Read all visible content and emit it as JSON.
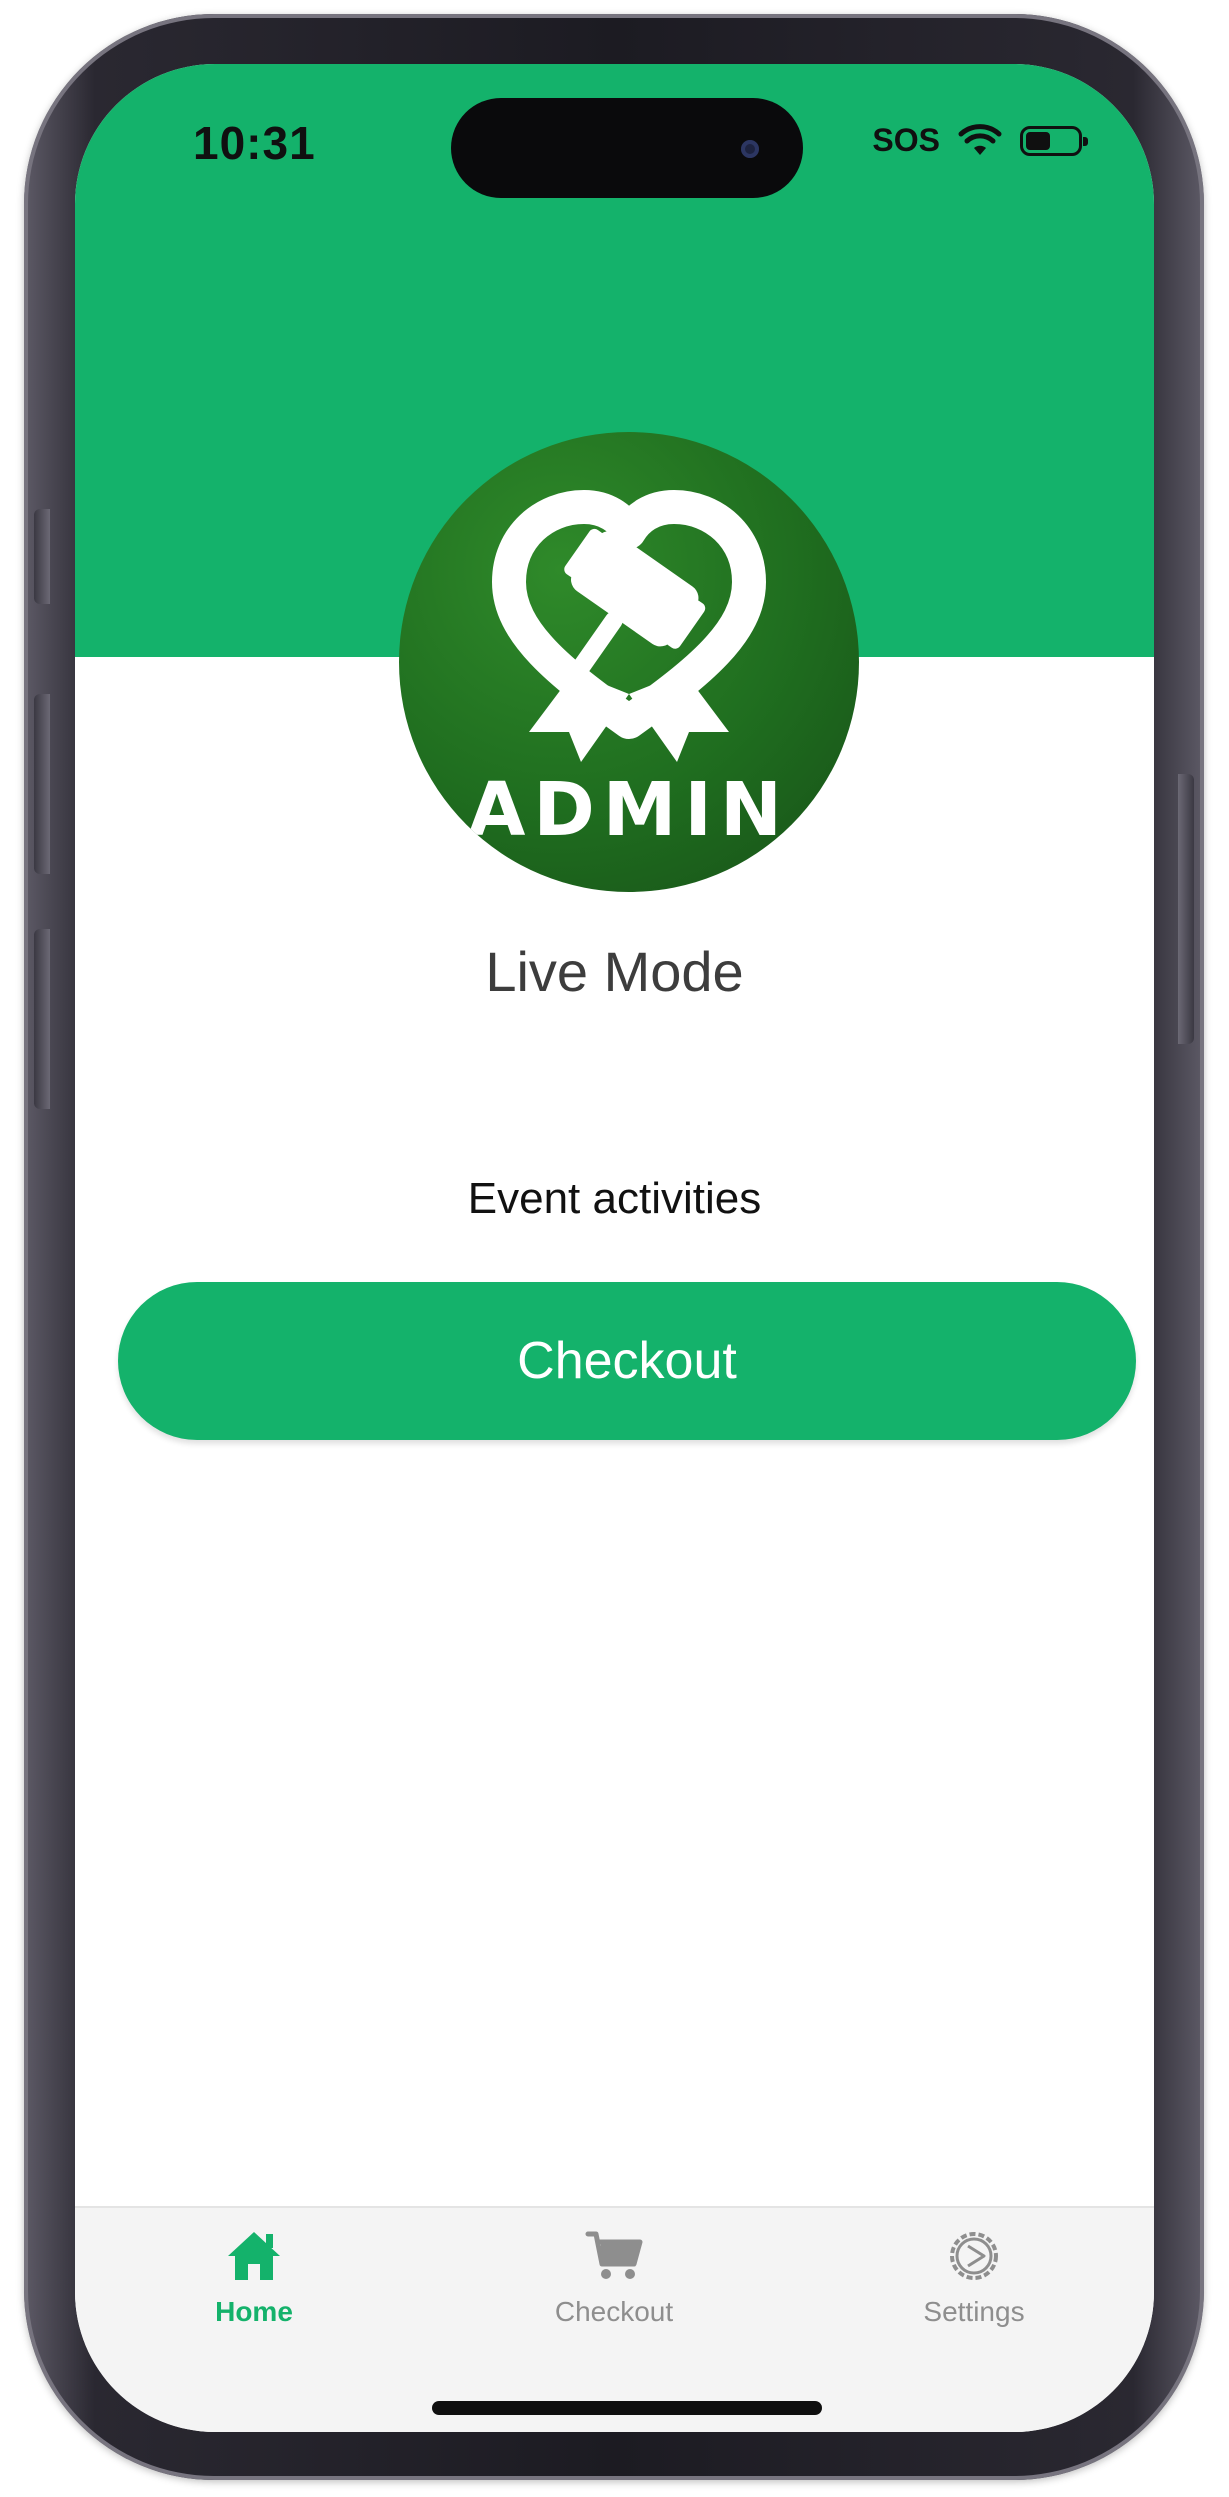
{
  "status_bar": {
    "time": "10:31",
    "sos": "SOS"
  },
  "logo": {
    "text": "ADMIN",
    "icon": "heart-gavel-ribbon-icon"
  },
  "main": {
    "mode_label": "Live Mode",
    "section_label": "Event activities",
    "checkout_button_label": "Checkout"
  },
  "tab_bar": {
    "items": [
      {
        "label": "Home",
        "icon": "home-icon",
        "active": true
      },
      {
        "label": "Checkout",
        "icon": "cart-icon",
        "active": false
      },
      {
        "label": "Settings",
        "icon": "gear-icon",
        "active": false
      }
    ]
  },
  "colors": {
    "brand_green": "#14b26b",
    "logo_green": "#1f6d1f",
    "tab_inactive": "#8e8e8e",
    "tab_bar_bg": "#f4f4f4"
  }
}
